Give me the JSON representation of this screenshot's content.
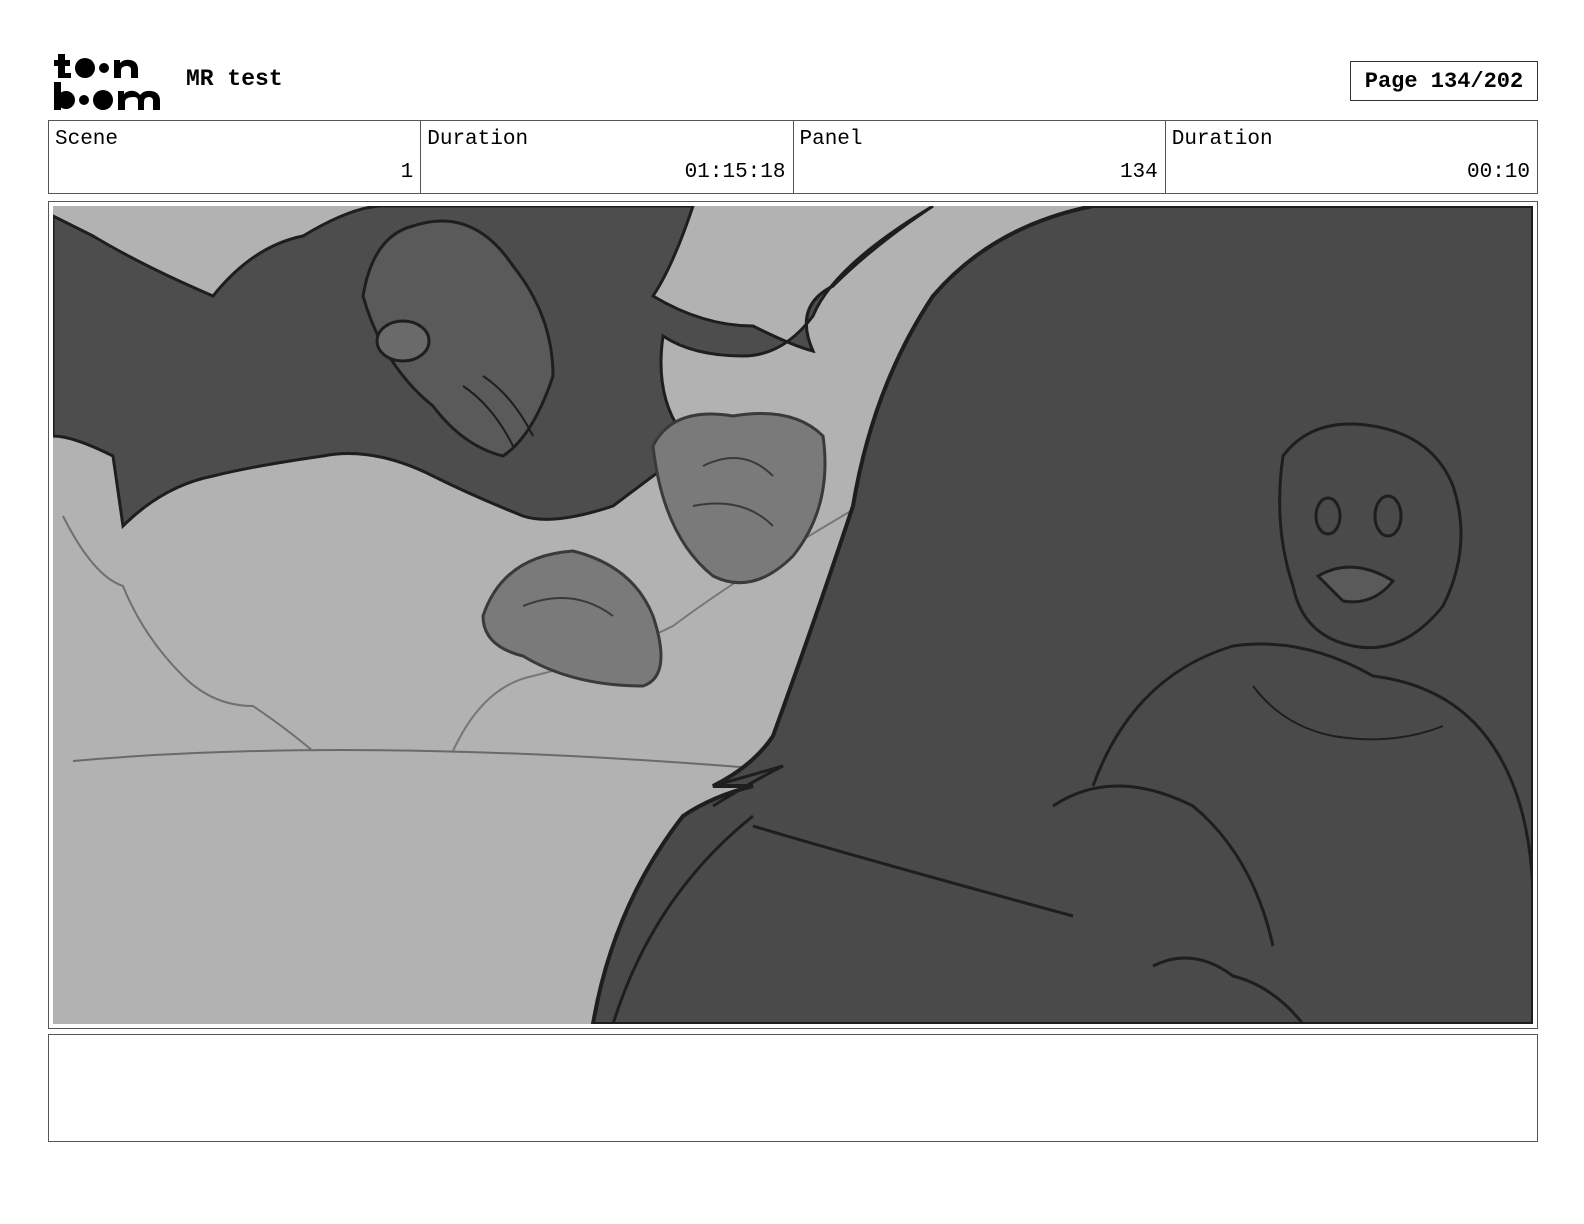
{
  "header": {
    "logo_alt": "toon boom",
    "project_title": "MR test",
    "page_label": "Page 134/202"
  },
  "info": {
    "scene_label": "Scene",
    "scene_value": "1",
    "scene_duration_label": "Duration",
    "scene_duration_value": "01:15:18",
    "panel_label": "Panel",
    "panel_value": "134",
    "panel_duration_label": "Duration",
    "panel_duration_value": "00:10"
  },
  "panel": {
    "image_name": "storyboard-sketch",
    "colors": {
      "sky": "#b2b2b2",
      "shadow": "#4a4a4a",
      "mid": "#7a7a7a",
      "line": "#1e1e1e"
    }
  },
  "notes": {
    "text": ""
  }
}
